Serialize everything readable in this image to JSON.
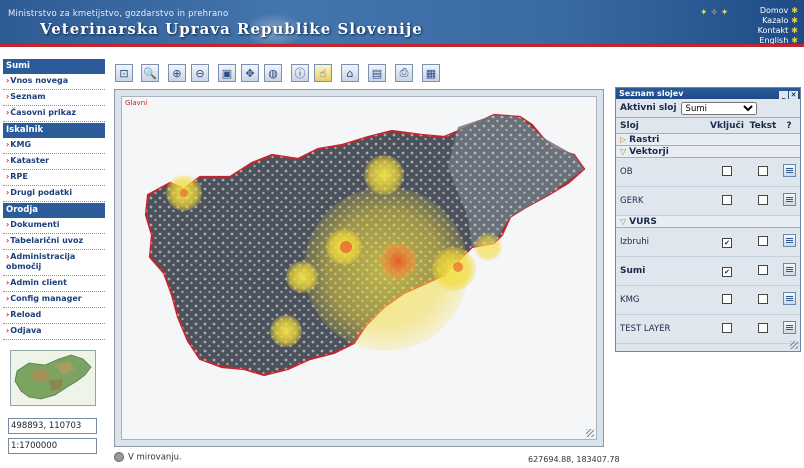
{
  "header": {
    "ministry": "Ministrstvo za kmetijstvo, gozdarstvo in prehrano",
    "title": "Veterinarska Uprava Republike Slovenije",
    "links": [
      "Domov",
      "Kazalo",
      "Kontakt",
      "English"
    ]
  },
  "sidebar": {
    "sections": [
      {
        "title": "Sumi",
        "items": [
          "Vnos novega",
          "Seznam",
          "Časovni prikaz"
        ]
      },
      {
        "title": "Iskalnik",
        "items": [
          "KMG",
          "Kataster",
          "RPE",
          "Drugi podatki"
        ]
      },
      {
        "title": "Orodja",
        "items": [
          "Dokumenti",
          "Tabelarični uvoz",
          "Administracija območij",
          "Admin client",
          "Config manager",
          "Reload",
          "Odjava"
        ]
      }
    ],
    "coordinates": "498893, 110703",
    "scale": "1:1700000"
  },
  "toolbar": {
    "icons": [
      "zoom-extent-icon",
      "zoom-search-icon",
      "zoom-in-icon",
      "zoom-out-icon",
      "zoom-box-icon",
      "pan-icon",
      "globe-icon",
      "identify-icon",
      "select-icon",
      "home-icon",
      "layers-icon",
      "print-icon",
      "legend-icon"
    ],
    "active_index": 8
  },
  "map": {
    "label": "Glavni",
    "status": "V mirovanju.",
    "coords": "627694.88, 183407.78"
  },
  "layers_panel": {
    "title": "Seznam slojev",
    "active_label": "Aktivni sloj",
    "active_value": "Sumi",
    "columns": [
      "Sloj",
      "Vključi",
      "Tekst",
      "?"
    ],
    "groups": [
      {
        "name": "Rastri",
        "expanded": false,
        "layers": []
      },
      {
        "name": "Vektorji",
        "expanded": true,
        "layers": [
          {
            "name": "OB",
            "on": false,
            "text": false,
            "bold": false
          },
          {
            "name": "GERK",
            "on": false,
            "text": false,
            "bold": false
          }
        ]
      },
      {
        "name": "VURS",
        "expanded": true,
        "layers": [
          {
            "name": "Izbruhi",
            "on": true,
            "text": false,
            "bold": false
          },
          {
            "name": "Sumi",
            "on": true,
            "text": false,
            "bold": true
          },
          {
            "name": "KMG",
            "on": false,
            "text": false,
            "bold": false
          },
          {
            "name": "TEST LAYER",
            "on": false,
            "text": false,
            "bold": false
          }
        ]
      }
    ]
  },
  "colors": {
    "brand_blue": "#2b5c99",
    "accent_red": "#c0262d",
    "hotspot_yellow": "#f2e25a",
    "hotspot_red": "#e8672a"
  }
}
